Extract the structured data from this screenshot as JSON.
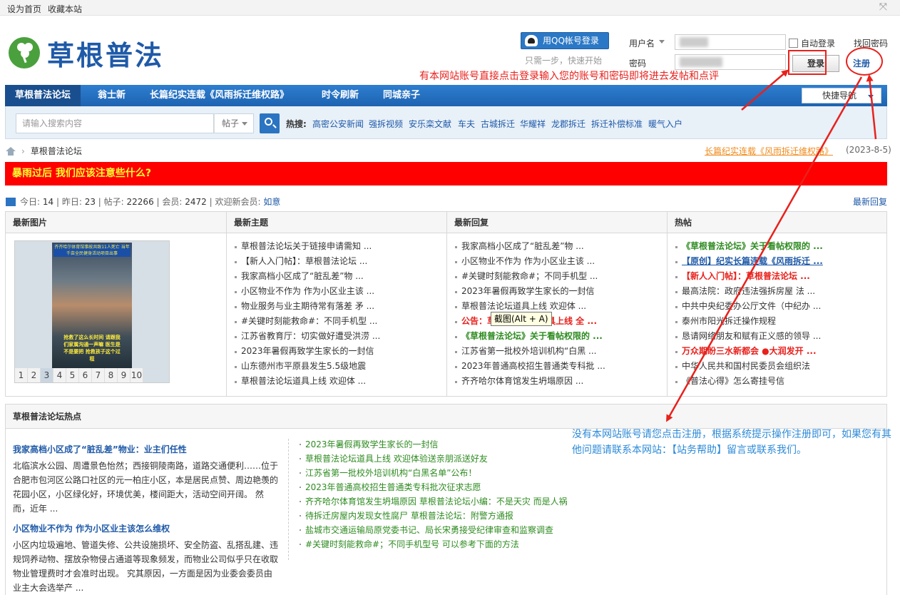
{
  "topbar": {
    "set_home": "设为首页",
    "bookmark": "收藏本站"
  },
  "logo": {
    "text": "草根普法"
  },
  "qq_login": {
    "label": "用QQ帐号登录",
    "hint": "只需一步，快速开始"
  },
  "login": {
    "username_label": "用户名",
    "password_label": "密码",
    "auto_login": "自动登录",
    "find_password": "找回密码",
    "login_button": "登录",
    "register_button": "注册"
  },
  "annotations": {
    "red_note": "有本网站账号直接点击登录输入您的账号和密码即将进去发帖和点评",
    "blue_note": "没有本网站账号请您点击注册，根据系统提示操作注册即可，如果您有其他问题请联系本网站：【站务帮助】留言或联系我们。"
  },
  "nav": {
    "items": [
      "草根普法论坛",
      "翁士新",
      "长篇纪实连载《风雨拆迁维权路》",
      "时令刷新",
      "同城亲子"
    ],
    "quick_nav": "快捷导航"
  },
  "search": {
    "placeholder": "请输入搜索内容",
    "type": "帖子",
    "hot_label": "热搜:",
    "hot_keywords": [
      "高密公安新闻",
      "强拆视频",
      "安乐栾文献",
      "车夫",
      "古城拆迁",
      "华耀祥",
      "龙郡拆迁",
      "拆迁补偿标准",
      "暖气入户"
    ]
  },
  "breadcrumb": {
    "current": "草根普法论坛",
    "promo_link": "长篇纪实连载《风雨拆迁维权路》",
    "date": "(2023-8-5)"
  },
  "alert": {
    "text": "暴雨过后 我们应该注意些什么?"
  },
  "stats": {
    "today_label": "今日:",
    "today": "14",
    "yesterday_label": "昨日:",
    "yesterday": "23",
    "posts_label": "帖子:",
    "posts": "22266",
    "members_label": "会员:",
    "members": "2472",
    "welcome_label": "欢迎新会员:",
    "new_member": "如意",
    "latest_reply": "最新回复"
  },
  "grid": {
    "images_head": "最新图片",
    "topics_head": "最新主题",
    "replies_head": "最新回复",
    "hot_head": "热帖",
    "photo_caption": "齐齐哈尔体育馆事故共致11人死亡 当年千亩全民健身活动项目出事",
    "photo_subtitle": "抢救了这么长时间 请跟我们家属沟通一声嘛 医生是不是要把 抢救孩子这个过程",
    "pager": [
      "1",
      "2",
      "3",
      "4",
      "5",
      "6",
      "7",
      "8",
      "9",
      "10"
    ],
    "topics": [
      "草根普法论坛关于链接申请需知 ...",
      "【新人入门帖】：草根普法论坛 ...",
      "我家高档小区成了“脏乱差”物 ...",
      "小区物业不作为 作为小区业主该 ...",
      "物业服务与业主期待常有落差 矛 ...",
      "#关键时刻能救命#：不同手机型 ...",
      "江苏省教育厅：切实做好遭受洪涝 ...",
      "2023年暑假再致学生家长的一封信",
      "山东德州市平原县发生5.5级地震",
      "草根普法论坛道具上线 欢迎体 ..."
    ],
    "replies": [
      "我家高档小区成了“脏乱差”物 ...",
      "小区物业不作为 作为小区业主该 ...",
      "#关键时刻能救命#；不同手机型 ...",
      "2023年暑假再致学生家长的一封信",
      "草根普法论坛道具上线 欢迎体 ...",
      "公告：草根普法论坛道具上线 全 ...",
      "《草根普法论坛》关于看帖权限的 ...",
      "江苏省第一批校外培训机构“白黑 ...",
      "2023年普通高校招生普通类专科批 ...",
      "齐齐哈尔体育馆发生坍塌原因 ..."
    ],
    "hot": [
      "《草根普法论坛》关于看帖权限的 ...",
      "【原创】纪实长篇连载《风雨拆迁 ...",
      "【新人入门帖】：草根普法论坛 ...",
      "最高法院：政府违法强拆房屋 法 ...",
      "中共中央纪委办公厅文件（中纪办 ...",
      "泰州市阳光拆迁操作规程",
      "恳请网络朋友和赋有正义感的领导 ...",
      "万众期盼三水新都会 ●大润发开 ...",
      "中华人民共和国村民委员会组织法",
      "《普法心得》怎么寄挂号信"
    ],
    "tooltip": "截图(Alt + A)"
  },
  "hot_section": {
    "head": "草根普法论坛热点",
    "articles": [
      {
        "title": "我家高档小区成了“脏乱差”物业：业主们任性",
        "body": "北临滨水公园、周遭景色怡然；西接铜陵南路，道路交通便利……位于合肥市包河区公路口社区的元一柏庄小区，本是居民点赞、周边艳羡的花园小区，小区绿化好，环境优美，楼间距大，活动空间开阔。 然而，近年 ..."
      },
      {
        "title": "小区物业不作为 作为小区业主该怎么维权",
        "body": "小区内垃圾遍地、管道失修、公共设施损坏、安全防盗、乱搭乱建、违规饲养动物、摆放杂物侵占通道等现象频发，而物业公司似乎只在收取物业管理费时才会准时出现。 究其原因，一方面是因为业委会委员由业主大会选举产 ..."
      }
    ],
    "list": [
      "2023年暑假再致学生家长的一封信",
      "草根普法论坛道具上线 欢迎体验送亲朋派送好友",
      "江苏省第一批校外培训机构“白黑名单”公布！",
      "2023年普通高校招生普通类专科批次征求志愿",
      "齐齐哈尔体育馆发生坍塌原因 草根普法论坛小编：不是天灾 而是人祸",
      "待拆迁房屋内发现女性腐尸 草根普法论坛：附警方通报",
      "盐城市交通运输局原党委书记、局长宋勇接受纪律审查和监察调查",
      "#关键时刻能救命#；不同手机型号 可以参考下面的方法"
    ]
  },
  "colors": {
    "nav_blue": "#1d63b2",
    "alert_red": "#ff0000",
    "annotation_red": "#e8211c",
    "annotation_blue": "#2c8ad8"
  }
}
